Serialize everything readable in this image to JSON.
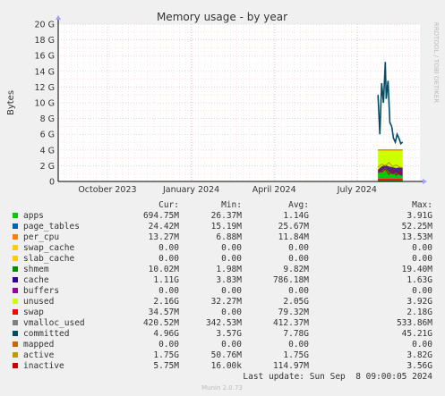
{
  "chart_data": {
    "type": "area",
    "title": "Memory usage - by year",
    "ylabel": "Bytes",
    "side_label": "RRDTOOL / TOBI OETIKER",
    "ylim": [
      0,
      20
    ],
    "y_unit": "G",
    "y_ticks": [
      {
        "value": 0,
        "label": "0"
      },
      {
        "value": 2,
        "label": "2 G"
      },
      {
        "value": 4,
        "label": "4 G"
      },
      {
        "value": 6,
        "label": "6 G"
      },
      {
        "value": 8,
        "label": "8 G"
      },
      {
        "value": 10,
        "label": "10 G"
      },
      {
        "value": 12,
        "label": "12 G"
      },
      {
        "value": 14,
        "label": "14 G"
      },
      {
        "value": 16,
        "label": "16 G"
      },
      {
        "value": 18,
        "label": "18 G"
      },
      {
        "value": 20,
        "label": "20 G"
      }
    ],
    "x_range": [
      "2023-08-08",
      "2024-09-08"
    ],
    "x_ticks": [
      {
        "date": "2023-10-01",
        "label": "October 2023"
      },
      {
        "date": "2024-01-01",
        "label": "January 2024"
      },
      {
        "date": "2024-04-01",
        "label": "April 2024"
      },
      {
        "date": "2024-07-01",
        "label": "July 2024"
      }
    ],
    "stack_end": {
      "date": "2024-08-20",
      "total": 4.0
    },
    "stack_order": [
      "apps",
      "page_tables",
      "per_cpu",
      "swap_cache",
      "slab_cache",
      "shmem",
      "cache",
      "buffers",
      "unused",
      "swap"
    ],
    "line_series": [
      "committed",
      "active",
      "mapped",
      "inactive",
      "vmalloc_used"
    ],
    "series_data": {
      "apps": {
        "x": [
          "2024-07-24",
          "2024-07-28",
          "2024-08-01",
          "2024-08-05",
          "2024-08-09",
          "2024-08-13",
          "2024-08-17",
          "2024-08-20"
        ],
        "y": [
          1.0,
          1.3,
          1.7,
          1.2,
          0.9,
          1.1,
          0.8,
          0.7
        ]
      },
      "shmem": {
        "x": [
          "2024-07-24",
          "2024-08-20"
        ],
        "y": [
          0.01,
          0.01
        ]
      },
      "cache": {
        "x": [
          "2024-07-24",
          "2024-07-28",
          "2024-08-01",
          "2024-08-05",
          "2024-08-09",
          "2024-08-13",
          "2024-08-17",
          "2024-08-20"
        ],
        "y": [
          0.5,
          0.6,
          0.4,
          0.7,
          0.9,
          0.6,
          1.0,
          1.1
        ]
      },
      "swap": {
        "x": [
          "2024-07-24",
          "2024-08-20"
        ],
        "y": [
          0.03,
          0.03
        ]
      },
      "committed": {
        "x": [
          "2024-07-24",
          "2024-07-26",
          "2024-07-28",
          "2024-07-30",
          "2024-08-01",
          "2024-08-02",
          "2024-08-04",
          "2024-08-06",
          "2024-08-08",
          "2024-08-10",
          "2024-08-12",
          "2024-08-14",
          "2024-08-16",
          "2024-08-18",
          "2024-08-20"
        ],
        "y": [
          11.0,
          6.0,
          12.5,
          10.0,
          15.2,
          10.5,
          12.8,
          7.5,
          7.0,
          5.5,
          5.0,
          6.0,
          5.5,
          4.8,
          5.0
        ]
      },
      "active": {
        "x": [
          "2024-07-24",
          "2024-07-28",
          "2024-08-01",
          "2024-08-05",
          "2024-08-09",
          "2024-08-13",
          "2024-08-17",
          "2024-08-20"
        ],
        "y": [
          1.8,
          2.2,
          2.0,
          2.4,
          1.9,
          2.1,
          1.8,
          1.75
        ]
      },
      "inactive": {
        "x": [
          "2024-07-24",
          "2024-07-28",
          "2024-08-01",
          "2024-08-05",
          "2024-08-09",
          "2024-08-13",
          "2024-08-17",
          "2024-08-20"
        ],
        "y": [
          1.5,
          1.2,
          1.6,
          0.9,
          1.4,
          0.8,
          1.2,
          1.0
        ]
      },
      "vmalloc_used": {
        "x": [
          "2024-07-24",
          "2024-08-20"
        ],
        "y": [
          0.4,
          0.42
        ]
      }
    },
    "legend_headers": [
      "Cur:",
      "Min:",
      "Avg:",
      "Max:"
    ],
    "series": [
      {
        "name": "apps",
        "color": "#00cc00",
        "cur": "694.75M",
        "min": "26.37M",
        "avg": "1.14G",
        "max": "3.91G"
      },
      {
        "name": "page_tables",
        "color": "#0066b3",
        "cur": "24.42M",
        "min": "15.19M",
        "avg": "25.67M",
        "max": "52.25M"
      },
      {
        "name": "per_cpu",
        "color": "#ff8000",
        "cur": "13.27M",
        "min": "6.88M",
        "avg": "11.84M",
        "max": "13.53M"
      },
      {
        "name": "swap_cache",
        "color": "#ffcc00",
        "cur": "0.00",
        "min": "0.00",
        "avg": "0.00",
        "max": "0.00"
      },
      {
        "name": "slab_cache",
        "color": "#ffcc00",
        "cur": "0.00",
        "min": "0.00",
        "avg": "0.00",
        "max": "0.00"
      },
      {
        "name": "shmem",
        "color": "#008f00",
        "cur": "10.02M",
        "min": "1.98M",
        "avg": "9.82M",
        "max": "19.40M"
      },
      {
        "name": "cache",
        "color": "#330099",
        "cur": "1.11G",
        "min": "3.83M",
        "avg": "786.18M",
        "max": "1.63G"
      },
      {
        "name": "buffers",
        "color": "#990099",
        "cur": "0.00",
        "min": "0.00",
        "avg": "0.00",
        "max": "0.00"
      },
      {
        "name": "unused",
        "color": "#ccff00",
        "cur": "2.16G",
        "min": "32.27M",
        "avg": "2.05G",
        "max": "3.92G"
      },
      {
        "name": "swap",
        "color": "#ff0000",
        "cur": "34.57M",
        "min": "0.00",
        "avg": "79.32M",
        "max": "2.18G"
      },
      {
        "name": "vmalloc_used",
        "color": "#808080",
        "cur": "420.52M",
        "min": "342.53M",
        "avg": "412.37M",
        "max": "533.86M"
      },
      {
        "name": "committed",
        "color": "#004d66",
        "cur": "4.96G",
        "min": "3.57G",
        "avg": "7.78G",
        "max": "45.21G"
      },
      {
        "name": "mapped",
        "color": "#cc6600",
        "cur": "0.00",
        "min": "0.00",
        "avg": "0.00",
        "max": "0.00"
      },
      {
        "name": "active",
        "color": "#c89600",
        "cur": "1.75G",
        "min": "50.76M",
        "avg": "1.75G",
        "max": "3.82G"
      },
      {
        "name": "inactive",
        "color": "#cc0000",
        "cur": "5.75M",
        "min": "16.00k",
        "avg": "114.97M",
        "max": "3.56G"
      }
    ],
    "last_update": "Last update: Sun Sep  8 09:00:05 2024",
    "footer": "Munin 2.0.73",
    "colors": {
      "background": "#f0f0f0",
      "plot": "#ffffff",
      "grid_minor": "#ffcccc",
      "grid_major": "#d8c8c8",
      "axis": "#000000"
    }
  }
}
